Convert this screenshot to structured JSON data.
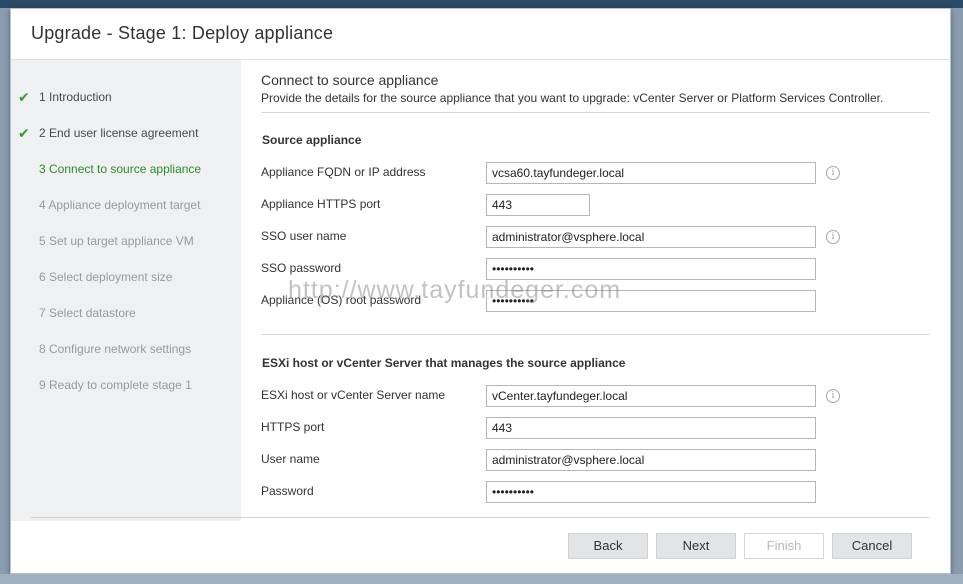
{
  "dialog": {
    "title": "Upgrade - Stage 1: Deploy appliance"
  },
  "sidebar": {
    "steps": [
      {
        "label": "1 Introduction",
        "state": "done"
      },
      {
        "label": "2 End user license agreement",
        "state": "done"
      },
      {
        "label": "3 Connect to source appliance",
        "state": "active"
      },
      {
        "label": "4 Appliance deployment target",
        "state": "pending"
      },
      {
        "label": "5 Set up target appliance VM",
        "state": "pending"
      },
      {
        "label": "6 Select deployment size",
        "state": "pending"
      },
      {
        "label": "7 Select datastore",
        "state": "pending"
      },
      {
        "label": "8 Configure network settings",
        "state": "pending"
      },
      {
        "label": "9 Ready to complete stage 1",
        "state": "pending"
      }
    ],
    "check_glyph": "✔"
  },
  "content": {
    "title": "Connect to source appliance",
    "description": "Provide the details for the source appliance that you want to upgrade: vCenter Server or Platform Services Controller.",
    "source": {
      "heading": "Source appliance",
      "fqdn_label": "Appliance FQDN or IP address",
      "fqdn_value": "vcsa60.tayfundeger.local",
      "https_port_label": "Appliance HTTPS port",
      "https_port_value": "443",
      "sso_user_label": "SSO user name",
      "sso_user_value": "administrator@vsphere.local",
      "sso_password_label": "SSO password",
      "sso_password_value": "••••••••••",
      "root_password_label": "Appliance (OS) root password",
      "root_password_value": "••••••••••"
    },
    "esxi": {
      "heading": "ESXi host or vCenter Server that manages the source appliance",
      "server_label": "ESXi host or vCenter Server name",
      "server_value": "vCenter.tayfundeger.local",
      "https_port_label": "HTTPS port",
      "https_port_value": "443",
      "user_label": "User name",
      "user_value": "administrator@vsphere.local",
      "password_label": "Password",
      "password_value": "••••••••••"
    },
    "info_glyph": "i"
  },
  "watermark": "http://www.tayfundeger.com",
  "footer": {
    "back_label": "Back",
    "next_label": "Next",
    "finish_label": "Finish",
    "cancel_label": "Cancel"
  },
  "colors": {
    "active_step": "#2e8b2e",
    "check": "#3a9a3a",
    "sidebar_bg": "#eef0f2"
  }
}
